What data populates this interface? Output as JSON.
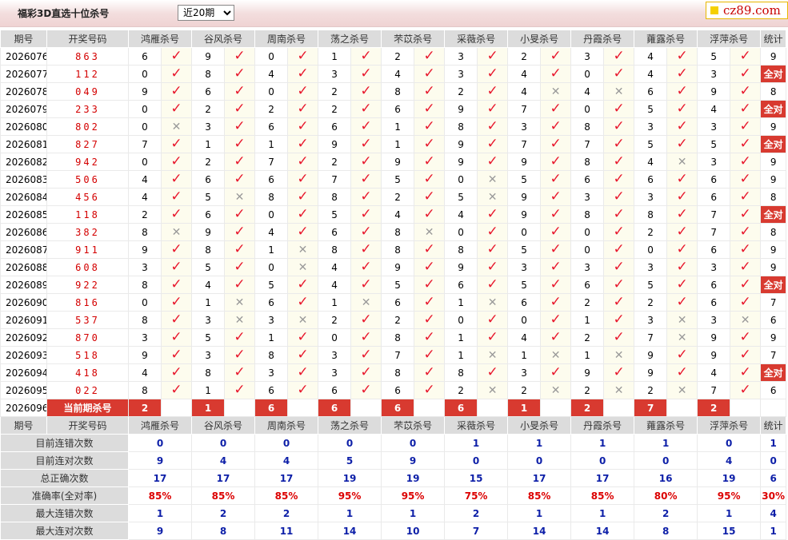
{
  "header": {
    "title": "福彩3D直选十位杀号",
    "period_selected": "近20期",
    "logo_text": "cz89.com"
  },
  "table": {
    "columns": [
      "期号",
      "开奖号码",
      "鸿雁杀号",
      "谷风杀号",
      "周南杀号",
      "荡之杀号",
      "芣苡杀号",
      "采薇杀号",
      "小旻杀号",
      "丹霞杀号",
      "蕹露杀号",
      "浮萍杀号",
      "统计"
    ],
    "rows": [
      {
        "period": "2026076",
        "draw": "863",
        "cells": [
          [
            6,
            1
          ],
          [
            9,
            1
          ],
          [
            0,
            1
          ],
          [
            1,
            1
          ],
          [
            2,
            1
          ],
          [
            3,
            1
          ],
          [
            2,
            1
          ],
          [
            3,
            1
          ],
          [
            4,
            1
          ],
          [
            5,
            1
          ]
        ],
        "stat": "9",
        "all": false
      },
      {
        "period": "2026077",
        "draw": "112",
        "cells": [
          [
            0,
            1
          ],
          [
            8,
            1
          ],
          [
            4,
            1
          ],
          [
            3,
            1
          ],
          [
            4,
            1
          ],
          [
            3,
            1
          ],
          [
            4,
            1
          ],
          [
            0,
            1
          ],
          [
            4,
            1
          ],
          [
            3,
            1
          ]
        ],
        "stat": "全对",
        "all": true
      },
      {
        "period": "2026078",
        "draw": "049",
        "cells": [
          [
            9,
            1
          ],
          [
            6,
            1
          ],
          [
            0,
            1
          ],
          [
            2,
            1
          ],
          [
            8,
            1
          ],
          [
            2,
            1
          ],
          [
            4,
            0
          ],
          [
            4,
            0
          ],
          [
            6,
            1
          ],
          [
            9,
            1
          ]
        ],
        "stat": "8",
        "all": false
      },
      {
        "period": "2026079",
        "draw": "233",
        "cells": [
          [
            0,
            1
          ],
          [
            2,
            1
          ],
          [
            2,
            1
          ],
          [
            2,
            1
          ],
          [
            6,
            1
          ],
          [
            9,
            1
          ],
          [
            7,
            1
          ],
          [
            0,
            1
          ],
          [
            5,
            1
          ],
          [
            4,
            1
          ]
        ],
        "stat": "全对",
        "all": true
      },
      {
        "period": "2026080",
        "draw": "802",
        "cells": [
          [
            0,
            0
          ],
          [
            3,
            1
          ],
          [
            6,
            1
          ],
          [
            6,
            1
          ],
          [
            1,
            1
          ],
          [
            8,
            1
          ],
          [
            3,
            1
          ],
          [
            8,
            1
          ],
          [
            3,
            1
          ],
          [
            3,
            1
          ]
        ],
        "stat": "9",
        "all": false
      },
      {
        "period": "2026081",
        "draw": "827",
        "cells": [
          [
            7,
            1
          ],
          [
            1,
            1
          ],
          [
            1,
            1
          ],
          [
            9,
            1
          ],
          [
            1,
            1
          ],
          [
            9,
            1
          ],
          [
            7,
            1
          ],
          [
            7,
            1
          ],
          [
            5,
            1
          ],
          [
            5,
            1
          ]
        ],
        "stat": "全对",
        "all": true
      },
      {
        "period": "2026082",
        "draw": "942",
        "cells": [
          [
            0,
            1
          ],
          [
            2,
            1
          ],
          [
            7,
            1
          ],
          [
            2,
            1
          ],
          [
            9,
            1
          ],
          [
            9,
            1
          ],
          [
            9,
            1
          ],
          [
            8,
            1
          ],
          [
            4,
            0
          ],
          [
            3,
            1
          ]
        ],
        "stat": "9",
        "all": false
      },
      {
        "period": "2026083",
        "draw": "506",
        "cells": [
          [
            4,
            1
          ],
          [
            6,
            1
          ],
          [
            6,
            1
          ],
          [
            7,
            1
          ],
          [
            5,
            1
          ],
          [
            0,
            0
          ],
          [
            5,
            1
          ],
          [
            6,
            1
          ],
          [
            6,
            1
          ],
          [
            6,
            1
          ]
        ],
        "stat": "9",
        "all": false
      },
      {
        "period": "2026084",
        "draw": "456",
        "cells": [
          [
            4,
            1
          ],
          [
            5,
            0
          ],
          [
            8,
            1
          ],
          [
            8,
            1
          ],
          [
            2,
            1
          ],
          [
            5,
            0
          ],
          [
            9,
            1
          ],
          [
            3,
            1
          ],
          [
            3,
            1
          ],
          [
            6,
            1
          ]
        ],
        "stat": "8",
        "all": false
      },
      {
        "period": "2026085",
        "draw": "118",
        "cells": [
          [
            2,
            1
          ],
          [
            6,
            1
          ],
          [
            0,
            1
          ],
          [
            5,
            1
          ],
          [
            4,
            1
          ],
          [
            4,
            1
          ],
          [
            9,
            1
          ],
          [
            8,
            1
          ],
          [
            8,
            1
          ],
          [
            7,
            1
          ]
        ],
        "stat": "全对",
        "all": true
      },
      {
        "period": "2026086",
        "draw": "382",
        "cells": [
          [
            8,
            0
          ],
          [
            9,
            1
          ],
          [
            4,
            1
          ],
          [
            6,
            1
          ],
          [
            8,
            0
          ],
          [
            0,
            1
          ],
          [
            0,
            1
          ],
          [
            0,
            1
          ],
          [
            2,
            1
          ],
          [
            7,
            1
          ]
        ],
        "stat": "8",
        "all": false
      },
      {
        "period": "2026087",
        "draw": "911",
        "cells": [
          [
            9,
            1
          ],
          [
            8,
            1
          ],
          [
            1,
            0
          ],
          [
            8,
            1
          ],
          [
            8,
            1
          ],
          [
            8,
            1
          ],
          [
            5,
            1
          ],
          [
            0,
            1
          ],
          [
            0,
            1
          ],
          [
            6,
            1
          ]
        ],
        "stat": "9",
        "all": false
      },
      {
        "period": "2026088",
        "draw": "608",
        "cells": [
          [
            3,
            1
          ],
          [
            5,
            1
          ],
          [
            0,
            0
          ],
          [
            4,
            1
          ],
          [
            9,
            1
          ],
          [
            9,
            1
          ],
          [
            3,
            1
          ],
          [
            3,
            1
          ],
          [
            3,
            1
          ],
          [
            3,
            1
          ]
        ],
        "stat": "9",
        "all": false
      },
      {
        "period": "2026089",
        "draw": "922",
        "cells": [
          [
            8,
            1
          ],
          [
            4,
            1
          ],
          [
            5,
            1
          ],
          [
            4,
            1
          ],
          [
            5,
            1
          ],
          [
            6,
            1
          ],
          [
            5,
            1
          ],
          [
            6,
            1
          ],
          [
            5,
            1
          ],
          [
            6,
            1
          ]
        ],
        "stat": "全对",
        "all": true
      },
      {
        "period": "2026090",
        "draw": "816",
        "cells": [
          [
            0,
            1
          ],
          [
            1,
            0
          ],
          [
            6,
            1
          ],
          [
            1,
            0
          ],
          [
            6,
            1
          ],
          [
            1,
            0
          ],
          [
            6,
            1
          ],
          [
            2,
            1
          ],
          [
            2,
            1
          ],
          [
            6,
            1
          ]
        ],
        "stat": "7",
        "all": false
      },
      {
        "period": "2026091",
        "draw": "537",
        "cells": [
          [
            8,
            1
          ],
          [
            3,
            0
          ],
          [
            3,
            0
          ],
          [
            2,
            1
          ],
          [
            2,
            1
          ],
          [
            0,
            1
          ],
          [
            0,
            1
          ],
          [
            1,
            1
          ],
          [
            3,
            0
          ],
          [
            3,
            0
          ]
        ],
        "stat": "6",
        "all": false
      },
      {
        "period": "2026092",
        "draw": "870",
        "cells": [
          [
            3,
            1
          ],
          [
            5,
            1
          ],
          [
            1,
            1
          ],
          [
            0,
            1
          ],
          [
            8,
            1
          ],
          [
            1,
            1
          ],
          [
            4,
            1
          ],
          [
            2,
            1
          ],
          [
            7,
            0
          ],
          [
            9,
            1
          ]
        ],
        "stat": "9",
        "all": false
      },
      {
        "period": "2026093",
        "draw": "518",
        "cells": [
          [
            9,
            1
          ],
          [
            3,
            1
          ],
          [
            8,
            1
          ],
          [
            3,
            1
          ],
          [
            7,
            1
          ],
          [
            1,
            0
          ],
          [
            1,
            0
          ],
          [
            1,
            0
          ],
          [
            9,
            1
          ],
          [
            9,
            1
          ]
        ],
        "stat": "7",
        "all": false
      },
      {
        "period": "2026094",
        "draw": "418",
        "cells": [
          [
            4,
            1
          ],
          [
            8,
            1
          ],
          [
            3,
            1
          ],
          [
            3,
            1
          ],
          [
            8,
            1
          ],
          [
            8,
            1
          ],
          [
            3,
            1
          ],
          [
            9,
            1
          ],
          [
            9,
            1
          ],
          [
            4,
            1
          ]
        ],
        "stat": "全对",
        "all": true
      },
      {
        "period": "2026095",
        "draw": "022",
        "cells": [
          [
            8,
            1
          ],
          [
            1,
            1
          ],
          [
            6,
            1
          ],
          [
            6,
            1
          ],
          [
            6,
            1
          ],
          [
            2,
            0
          ],
          [
            2,
            0
          ],
          [
            2,
            0
          ],
          [
            2,
            0
          ],
          [
            7,
            1
          ]
        ],
        "stat": "6",
        "all": false
      }
    ],
    "current": {
      "period": "2026096",
      "label": "当前期杀号",
      "values": [
        "2",
        "1",
        "6",
        "6",
        "6",
        "6",
        "1",
        "2",
        "7",
        "2"
      ]
    },
    "stats": [
      {
        "label": "目前连错次数",
        "values": [
          "0",
          "0",
          "0",
          "0",
          "0",
          "1",
          "1",
          "1",
          "1",
          "0",
          "1"
        ]
      },
      {
        "label": "目前连对次数",
        "values": [
          "9",
          "4",
          "4",
          "5",
          "9",
          "0",
          "0",
          "0",
          "0",
          "4",
          "0"
        ]
      },
      {
        "label": "总正确次数",
        "values": [
          "17",
          "17",
          "17",
          "19",
          "19",
          "15",
          "17",
          "17",
          "16",
          "19",
          "6"
        ]
      },
      {
        "label": "准确率(全对率)",
        "values": [
          "85%",
          "85%",
          "85%",
          "95%",
          "95%",
          "75%",
          "85%",
          "85%",
          "80%",
          "95%",
          "30%"
        ],
        "rate": true
      },
      {
        "label": "最大连错次数",
        "values": [
          "1",
          "2",
          "2",
          "1",
          "1",
          "2",
          "1",
          "1",
          "2",
          "1",
          "4"
        ]
      },
      {
        "label": "最大连对次数",
        "values": [
          "9",
          "8",
          "11",
          "14",
          "10",
          "7",
          "14",
          "14",
          "8",
          "15",
          "1"
        ]
      }
    ]
  },
  "icons": {
    "correct": "check-icon",
    "wrong": "cross-icon"
  },
  "colors": {
    "correct": "#e8172c",
    "wrong": "#9a9a9a",
    "accent": "#d83a30",
    "stat_blue": "#0d1fa8",
    "stat_red": "#dc0000"
  }
}
